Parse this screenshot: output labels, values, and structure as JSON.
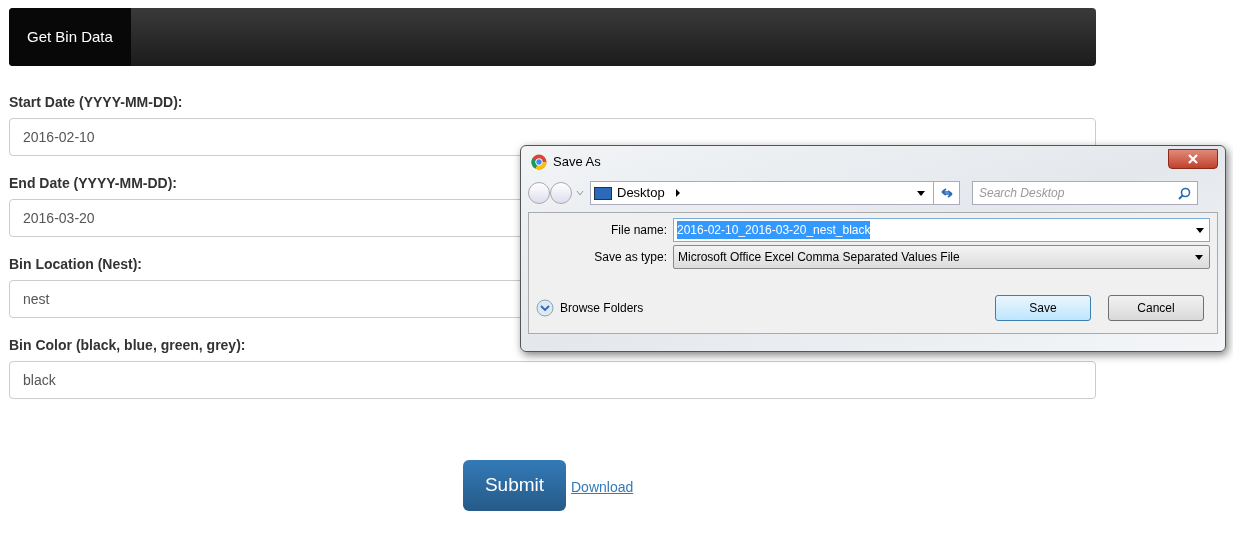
{
  "navbar": {
    "brand": "Get Bin Data"
  },
  "fields": [
    {
      "label": "Start Date (YYYY-MM-DD):",
      "value": "2016-02-10"
    },
    {
      "label": "End Date (YYYY-MM-DD):",
      "value": "2016-03-20"
    },
    {
      "label": "Bin Location (Nest):",
      "value": "nest"
    },
    {
      "label": "Bin Color (black, blue, green, grey):",
      "value": "black"
    }
  ],
  "submit": "Submit",
  "download": "Download",
  "dialog": {
    "title": "Save As",
    "location": "Desktop",
    "search_placeholder": "Search Desktop",
    "file_name_label": "File name:",
    "file_name": "2016-02-10_2016-03-20_nest_black",
    "type_label": "Save as type:",
    "type": "Microsoft Office Excel Comma Separated Values File",
    "browse": "Browse Folders",
    "expanded": false,
    "buttons": [
      "Save",
      "Cancel"
    ]
  }
}
